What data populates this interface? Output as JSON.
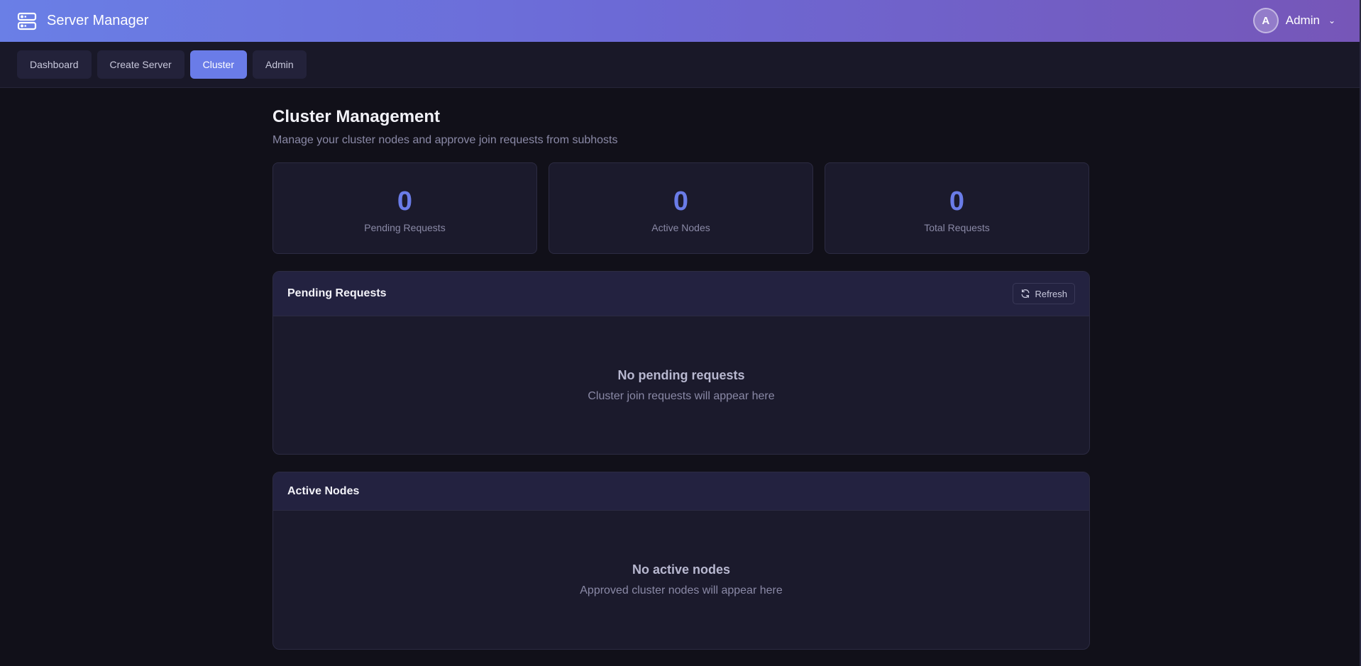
{
  "app": {
    "title": "Server Manager",
    "icon": "server-icon"
  },
  "user": {
    "initial": "A",
    "name": "Admin"
  },
  "nav": {
    "items": [
      {
        "label": "Dashboard",
        "active": false
      },
      {
        "label": "Create Server",
        "active": false
      },
      {
        "label": "Cluster",
        "active": true
      },
      {
        "label": "Admin",
        "active": false
      }
    ]
  },
  "page": {
    "title": "Cluster Management",
    "subtitle": "Manage your cluster nodes and approve join requests from subhosts"
  },
  "stats": [
    {
      "value": "0",
      "label": "Pending Requests"
    },
    {
      "value": "0",
      "label": "Active Nodes"
    },
    {
      "value": "0",
      "label": "Total Requests"
    }
  ],
  "pending_panel": {
    "title": "Pending Requests",
    "refresh_label": "Refresh",
    "empty_title": "No pending requests",
    "empty_text": "Cluster join requests will appear here"
  },
  "nodes_panel": {
    "title": "Active Nodes",
    "empty_title": "No active nodes",
    "empty_text": "Approved cluster nodes will appear here"
  },
  "colors": {
    "accent": "#6a7ce8",
    "background": "#111019",
    "card": "#1b1a2c"
  }
}
